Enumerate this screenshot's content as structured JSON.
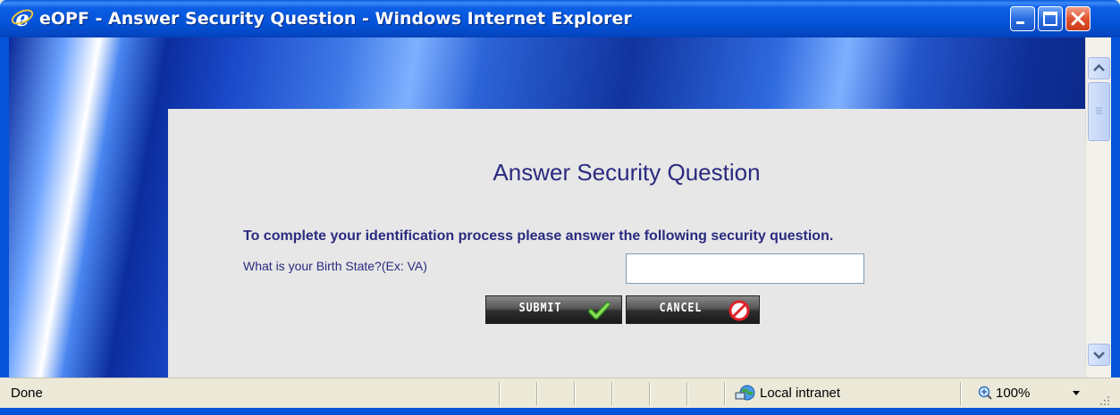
{
  "window": {
    "title": "eOPF - Answer Security Question - Windows Internet Explorer",
    "icon": "ie-logo-icon",
    "controls": [
      "minimize",
      "maximize",
      "close"
    ]
  },
  "page": {
    "heading": "Answer Security Question",
    "instruction": "To complete your identification process please answer the following security question.",
    "question": "What is your Birth State?(Ex: VA)",
    "answer_value": "",
    "submit_label": "SUBMIT",
    "cancel_label": "CANCEL"
  },
  "statusbar": {
    "status": "Done",
    "zone": "Local intranet",
    "zoom": "100%"
  },
  "colors": {
    "titlebar": "#0553d8",
    "heading_text": "#2a2a80",
    "panel_bg": "#e7e7e7",
    "close_button": "#e2532f"
  }
}
